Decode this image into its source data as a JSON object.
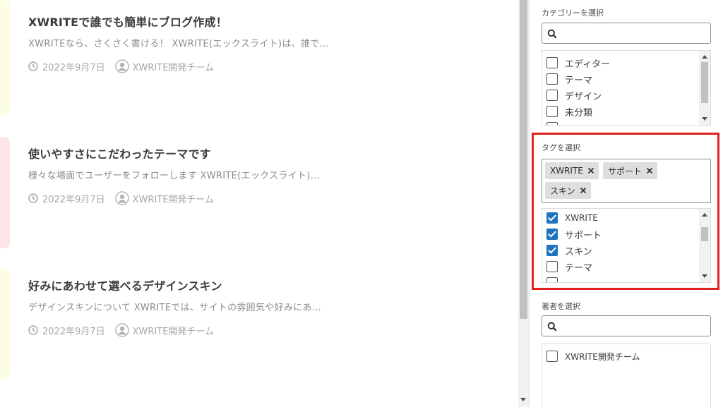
{
  "posts": [
    {
      "title": "XWRITEで誰でも簡単にブログ作成！",
      "excerpt": "XWRITEなら、さくさく書ける！ XWRITE(エックスライト)は、誰で…",
      "date": "2022年9月7日",
      "author": "XWRITE開発チーム",
      "accent_color": "#fdfde4"
    },
    {
      "title": "使いやすさにこだわったテーマです",
      "excerpt": "様々な場面でユーザーをフォローします XWRITE(エックスライト)…",
      "date": "2022年9月7日",
      "author": "XWRITE開発チーム",
      "accent_color": "#fde4e6"
    },
    {
      "title": "好みにあわせて選べるデザインスキン",
      "excerpt": "デザインスキンについて XWRITEでは、サイトの雰囲気や好みにあ…",
      "date": "2022年9月7日",
      "author": "XWRITE開発チーム",
      "accent_color": "#fdfde4"
    }
  ],
  "sidebar": {
    "category": {
      "label": "カテゴリーを選択",
      "search_value": "",
      "items": [
        {
          "label": "エディター",
          "checked": false
        },
        {
          "label": "テーマ",
          "checked": false
        },
        {
          "label": "デザイン",
          "checked": false
        },
        {
          "label": "未分類",
          "checked": false
        }
      ]
    },
    "tag": {
      "label": "タグを選択",
      "selected_chips": [
        "XWRITE",
        "サポート",
        "スキン"
      ],
      "items": [
        {
          "label": "XWRITE",
          "checked": true
        },
        {
          "label": "サポート",
          "checked": true
        },
        {
          "label": "スキン",
          "checked": true
        },
        {
          "label": "テーマ",
          "checked": false
        }
      ]
    },
    "author": {
      "label": "著者を選択",
      "search_value": "",
      "items": [
        {
          "label": "XWRITE開発チーム",
          "checked": false
        }
      ]
    }
  },
  "colors": {
    "highlight": "#e0201f",
    "checkbox_checked": "#1e73be"
  },
  "icons": {
    "date": "clock-icon",
    "author": "user-avatar-icon",
    "search": "search-icon",
    "chip_remove": "close-icon"
  }
}
